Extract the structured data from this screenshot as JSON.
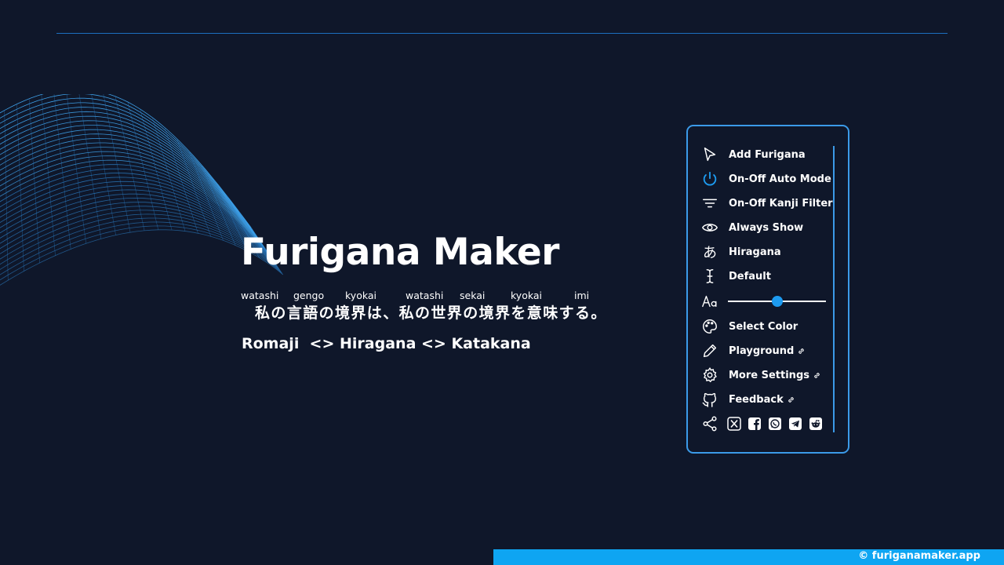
{
  "hero": {
    "title": "Furigana Maker",
    "ruby": [
      "watashi",
      "gengo",
      "kyokai",
      "watashi",
      "sekai",
      "kyokai",
      "imi"
    ],
    "japanese": "私の言語の境界は、私の世界の境界を意味する。",
    "modes": "Romaji  <> Hiragana <> Katakana"
  },
  "panel": {
    "items": [
      {
        "label": "Add Furigana",
        "icon": "cursor-icon",
        "external": false
      },
      {
        "label": "On-Off Auto Mode",
        "icon": "power-icon",
        "external": false
      },
      {
        "label": "On-Off Kanji Filter",
        "icon": "filter-icon",
        "external": false
      },
      {
        "label": "Always Show",
        "icon": "eye-icon",
        "external": false
      },
      {
        "label": "Hiragana",
        "icon": "hiragana-a-icon",
        "external": false
      },
      {
        "label": "Default",
        "icon": "text-cursor-icon",
        "external": false
      },
      {
        "label": "Select Color",
        "icon": "palette-icon",
        "external": false
      },
      {
        "label": "Playground",
        "icon": "pencil-icon",
        "external": true
      },
      {
        "label": "More Settings",
        "icon": "gear-icon",
        "external": true
      },
      {
        "label": "Feedback",
        "icon": "github-icon",
        "external": true
      }
    ],
    "font_size_slider": {
      "icon": "font-size-icon",
      "value_fraction": 0.5
    },
    "share": {
      "icon": "share-icon",
      "targets": [
        "x-icon",
        "facebook-icon",
        "whatsapp-icon",
        "telegram-icon",
        "reddit-icon"
      ]
    }
  },
  "footer": {
    "text": "© furiganamaker.app"
  },
  "colors": {
    "background": "#0f172a",
    "accent": "#3b9ae8",
    "footer": "#0ea5f2",
    "power_icon": "#1d9bf0"
  }
}
